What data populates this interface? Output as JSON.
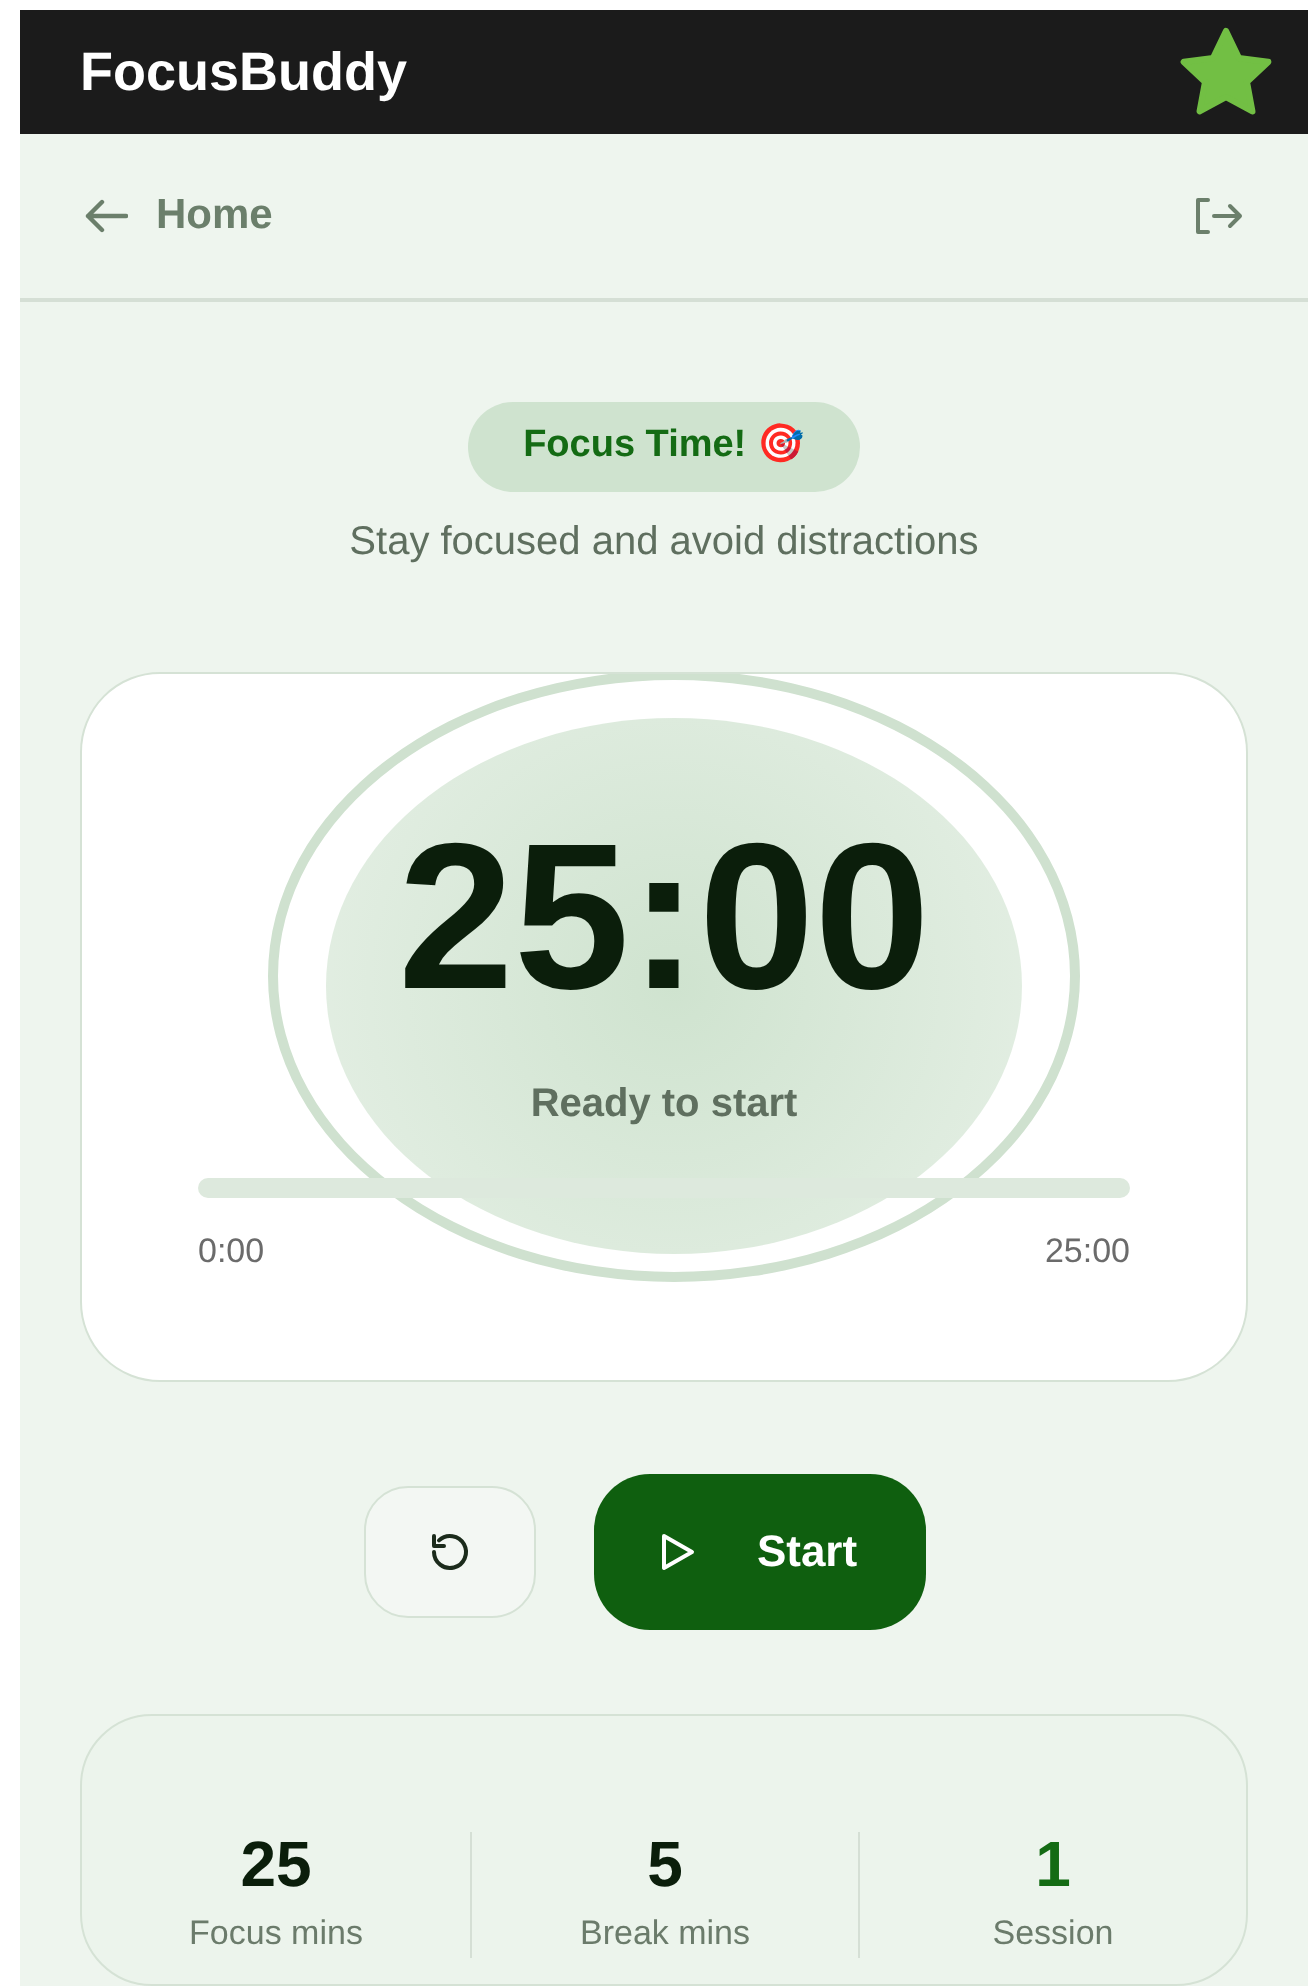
{
  "app_bar": {
    "title": "FocusBuddy"
  },
  "nav": {
    "back_label": "Home"
  },
  "mode": {
    "badge": "Focus Time! 🎯",
    "subtitle": "Stay focused and avoid distractions"
  },
  "timer": {
    "time": "25:00",
    "status": "Ready to start",
    "progress": {
      "level": 0,
      "start_label": "0:00",
      "end_label": "25:00"
    }
  },
  "controls": {
    "start_label": "Start"
  },
  "stats": [
    {
      "value": "25",
      "label": "Focus mins",
      "accent": false
    },
    {
      "value": "5",
      "label": "Break mins",
      "accent": false
    },
    {
      "value": "1",
      "label": "Session",
      "accent": true
    }
  ]
}
